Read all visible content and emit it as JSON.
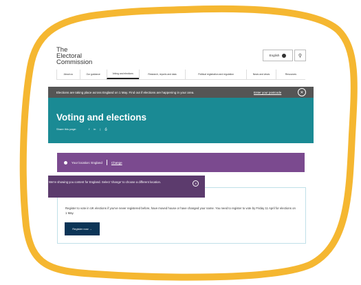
{
  "frame": {
    "color": "#f5b731"
  },
  "logo": {
    "line1": "The",
    "line2": "Electoral",
    "line3": "Commission"
  },
  "header": {
    "language_label": "English",
    "search_icon": "search-icon"
  },
  "nav": {
    "items": [
      {
        "label": "About us"
      },
      {
        "label": "Our guidance"
      },
      {
        "label": "Voting and elections"
      },
      {
        "label": "Research, reports and data"
      },
      {
        "label": "Political registration and regulation"
      },
      {
        "label": "News and views"
      },
      {
        "label": "Resources"
      }
    ],
    "active_index": 2
  },
  "banner": {
    "message": "Elections are taking place across England on 1 May. Find out if elections are happening in your area.",
    "link": "Enter your postcode",
    "close_icon": "close-icon",
    "color": "#555555"
  },
  "hero": {
    "title": "Voting and elections",
    "share_label": "Share this page:",
    "share_icons": [
      "facebook-icon",
      "linkedin-icon",
      "print-icon"
    ],
    "color": "#1a8a94"
  },
  "location": {
    "label": "Your location: England",
    "change_link": "Change",
    "color": "#7b4a8f"
  },
  "tooltip": {
    "text": "We're showing you content for England. Select 'change' to choose a different location.",
    "color": "#5c3b6d"
  },
  "card": {
    "text": "Register to vote in UK elections if you've never registered before, have moved house or have changed your name. You need to register to vote by Friday 11 April for elections on 1 May.",
    "button_label": "Register now →",
    "button_color": "#0c3557"
  }
}
